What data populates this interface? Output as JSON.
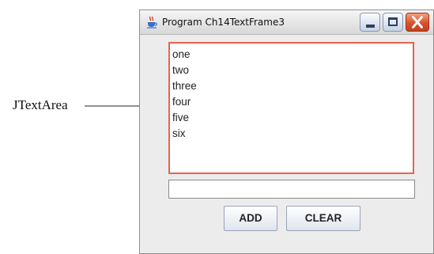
{
  "annotation": {
    "label": "JTextArea"
  },
  "window": {
    "title": "Program Ch14TextFrame3",
    "icons": {
      "app": "java-cup-icon",
      "minimize": "minimize-icon",
      "maximize": "maximize-icon",
      "close": "close-icon"
    },
    "textarea": {
      "lines": [
        "one",
        "two",
        "three",
        "four",
        "five",
        "six"
      ],
      "border_color": "#e8644c"
    },
    "textfield": {
      "value": ""
    },
    "buttons": {
      "add_label": "ADD",
      "clear_label": "CLEAR"
    }
  }
}
